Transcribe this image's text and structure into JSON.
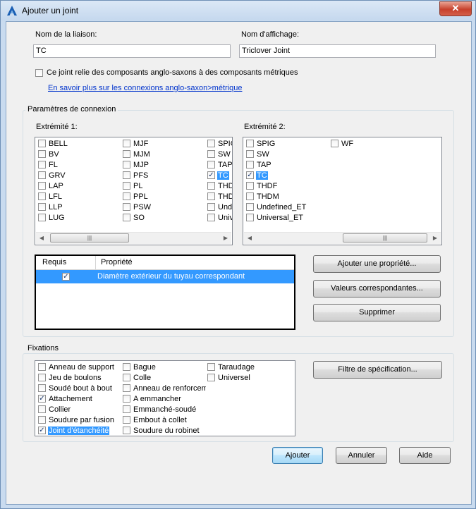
{
  "window": {
    "title": "Ajouter un joint",
    "close_glyph": "✕"
  },
  "fields": {
    "connection_name_label": "Nom de la liaison:",
    "connection_name_value": "TC",
    "display_name_label": "Nom d'affichage:",
    "display_name_value": "Triclover Joint"
  },
  "imperial_metric": {
    "checkbox_label": "Ce joint relie des composants anglo-saxons à des composants métriques",
    "checked": false,
    "link_text": "En savoir plus sur les connexions anglo-saxon>métrique"
  },
  "connection_params": {
    "group_title": "Paramètres de connexion",
    "end1": {
      "label": "Extrémité 1:",
      "col1": [
        "BELL",
        "BV",
        "FL",
        "GRV",
        "LAP",
        "LFL",
        "LLP",
        "LUG"
      ],
      "col2": [
        "MJF",
        "MJM",
        "MJP",
        "PFS",
        "PL",
        "PPL",
        "PSW",
        "SO"
      ],
      "col3": [
        "SPIG",
        "SW",
        "TAP",
        "TC",
        "THDF",
        "THDM",
        "Undefined_ET",
        "Universal_ET"
      ],
      "checked": "TC",
      "selected": "TC"
    },
    "end2": {
      "label": "Extrémité 2:",
      "col1": [
        "SPIG",
        "SW",
        "TAP",
        "TC",
        "THDF",
        "THDM",
        "Undefined_ET",
        "Universal_ET"
      ],
      "col2": [
        "WF"
      ],
      "checked": "TC",
      "selected": "TC"
    },
    "scroll_thumb_glyph": "|||",
    "scroll_left_glyph": "◀",
    "scroll_right_glyph": "▶",
    "properties_table": {
      "col_required": "Requis",
      "col_property": "Propriété",
      "rows": [
        {
          "required": true,
          "property": "Diamètre extérieur du tuyau correspondant"
        }
      ]
    },
    "buttons": {
      "add_property": "Ajouter une propriété...",
      "matching_values": "Valeurs correspondantes...",
      "delete": "Supprimer"
    }
  },
  "fasteners": {
    "group_title": "Fixations",
    "col1": [
      "Anneau de support",
      "Jeu de boulons",
      "Soudé bout à bout",
      "Attachement",
      "Collier",
      "Soudure par fusion",
      "Joint d'étanchéité"
    ],
    "col2": [
      "Bague",
      "Colle",
      "Anneau de renforcement",
      "A emmancher",
      "Emmanché-soudé",
      "Embout à collet",
      "Soudure du robinet"
    ],
    "col3": [
      "Taraudage",
      "Universel"
    ],
    "checked": [
      "Attachement",
      "Joint d'étanchéité"
    ],
    "selected": "Joint d'étanchéité",
    "spec_filter_button": "Filtre de spécification..."
  },
  "footer": {
    "add": "Ajouter",
    "cancel": "Annuler",
    "help": "Aide"
  },
  "colors": {
    "selection": "#3399ff",
    "link": "#0033cc",
    "close": "#c7412c"
  },
  "icons": {
    "app": "autocad-a-icon",
    "check": "✓"
  }
}
